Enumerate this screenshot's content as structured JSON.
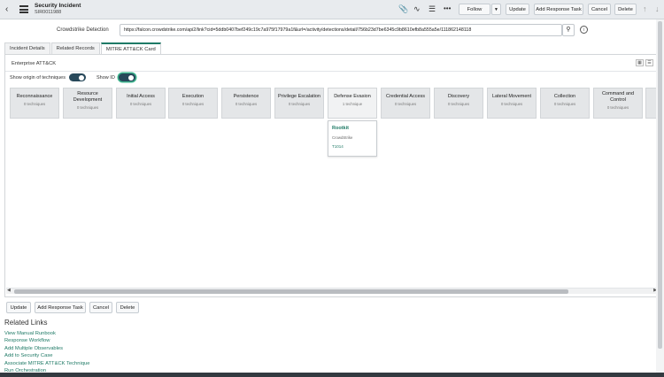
{
  "header": {
    "title": "Security Incident",
    "number": "SIR0011988",
    "follow_label": "Follow",
    "update_label": "Update",
    "add_response_task_label": "Add Response Task",
    "cancel_label": "Cancel",
    "delete_label": "Delete"
  },
  "form": {
    "crowdstrike_label": "Crowdstrike Detection",
    "crowdstrike_url": "https://falcon.crowdstrike.com/api2/link?cid=5ddb0407bef249c19c7a975f17979a1f&url=/activity/detections/detail/756b23d7be6345c9b8610efb8a555a5e/111862148118"
  },
  "tabs": [
    {
      "label": "Incident Details"
    },
    {
      "label": "Related Records"
    },
    {
      "label": "MITRE ATT&CK Card"
    }
  ],
  "mitre": {
    "title": "Enterprise ATT&CK",
    "show_origin_label": "Show origin of techniques",
    "show_id_label": "Show ID",
    "tactics": [
      {
        "name": "Reconnaissance",
        "count": "0 techniques"
      },
      {
        "name": "Resource Development",
        "count": "0 techniques"
      },
      {
        "name": "Initial Access",
        "count": "0 techniques"
      },
      {
        "name": "Execution",
        "count": "0 techniques"
      },
      {
        "name": "Persistence",
        "count": "0 techniques"
      },
      {
        "name": "Privilege Escalation",
        "count": "0 techniques"
      },
      {
        "name": "Defense Evasion",
        "count": "1 technique"
      },
      {
        "name": "Credential Access",
        "count": "0 techniques"
      },
      {
        "name": "Discovery",
        "count": "0 techniques"
      },
      {
        "name": "Lateral Movement",
        "count": "0 techniques"
      },
      {
        "name": "Collection",
        "count": "0 techniques"
      },
      {
        "name": "Command and Control",
        "count": "0 techniques"
      }
    ],
    "technique": {
      "name": "Rootkit",
      "source": "CrowdStrike",
      "id": "T1014"
    }
  },
  "footer_buttons": {
    "update_label": "Update",
    "add_response_task_label": "Add Response Task",
    "cancel_label": "Cancel",
    "delete_label": "Delete"
  },
  "related_links": {
    "title": "Related Links",
    "items": [
      {
        "label": "View Manual Runbook"
      },
      {
        "label": "Response Workflow"
      },
      {
        "label": "Add Multiple Observables"
      },
      {
        "label": "Add to Security Case"
      },
      {
        "label": "Associate MITRE ATT&CK Technique"
      },
      {
        "label": "Run Orchestration"
      }
    ]
  },
  "colors": {
    "accent": "#1f7a66",
    "toggle_on": "#27485a",
    "tactic_bg": "#e4e6e8"
  },
  "icons": [
    "back-icon",
    "hamburger-icon",
    "attachment-icon",
    "activity-icon",
    "settings-icon",
    "more-icon",
    "chevron-down-icon",
    "arrow-up-icon",
    "arrow-down-icon",
    "search-icon",
    "info-icon",
    "grid-view-icon",
    "list-view-icon"
  ]
}
